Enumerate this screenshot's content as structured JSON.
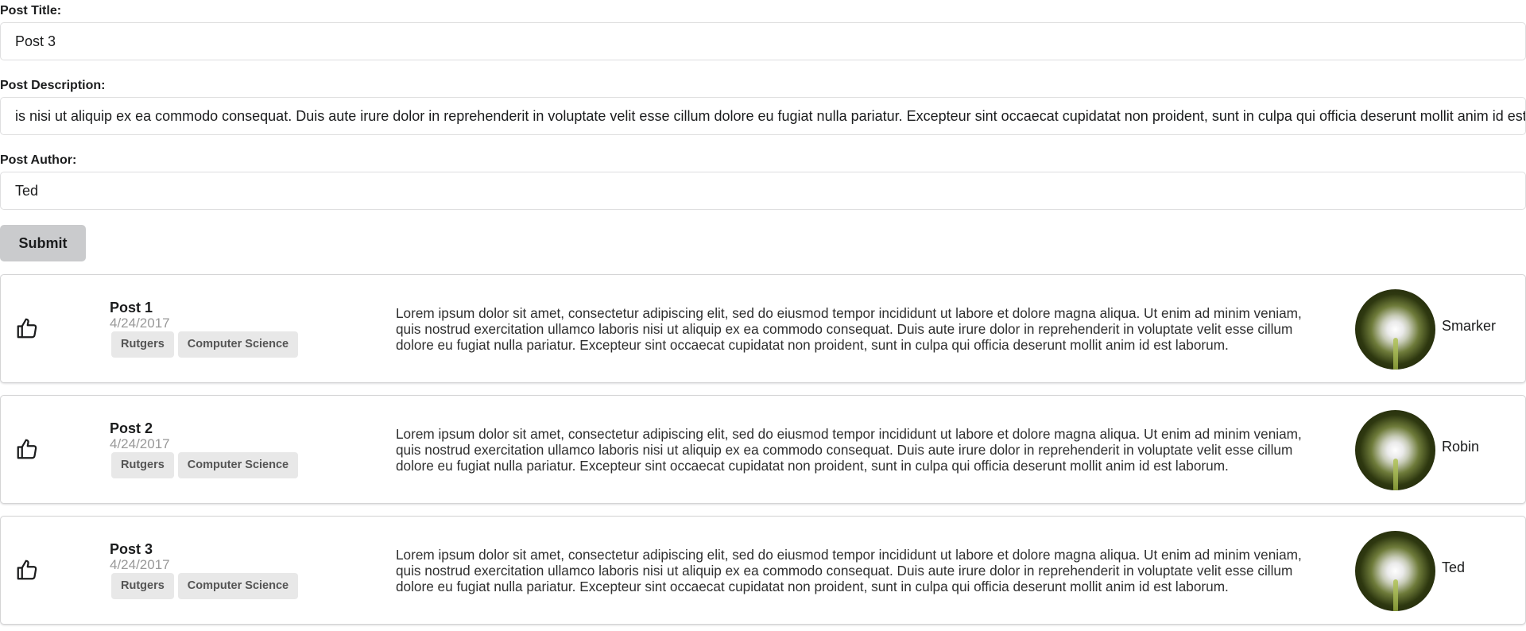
{
  "form": {
    "title_label": "Post Title:",
    "title_value": "Post 3",
    "description_label": "Post Description:",
    "description_value": "is nisi ut aliquip ex ea commodo consequat. Duis aute irure dolor in reprehenderit in voluptate velit esse cillum dolore eu fugiat nulla pariatur. Excepteur sint occaecat cupidatat non proident, sunt in culpa qui officia deserunt mollit anim id est laborum.",
    "author_label": "Post Author:",
    "author_value": "Ted",
    "submit_label": "Submit"
  },
  "posts": [
    {
      "title": "Post 1",
      "date": "4/24/2017",
      "tags": [
        "Rutgers",
        "Computer Science"
      ],
      "description": "Lorem ipsum dolor sit amet, consectetur adipiscing elit, sed do eiusmod tempor incididunt ut labore et dolore magna aliqua. Ut enim ad minim veniam, quis nostrud exercitation ullamco laboris nisi ut aliquip ex ea commodo consequat. Duis aute irure dolor in reprehenderit in voluptate velit esse cillum dolore eu fugiat nulla pariatur. Excepteur sint occaecat cupidatat non proident, sunt in culpa qui officia deserunt mollit anim id est laborum.",
      "author": "Smarker"
    },
    {
      "title": "Post 2",
      "date": "4/24/2017",
      "tags": [
        "Rutgers",
        "Computer Science"
      ],
      "description": "Lorem ipsum dolor sit amet, consectetur adipiscing elit, sed do eiusmod tempor incididunt ut labore et dolore magna aliqua. Ut enim ad minim veniam, quis nostrud exercitation ullamco laboris nisi ut aliquip ex ea commodo consequat. Duis aute irure dolor in reprehenderit in voluptate velit esse cillum dolore eu fugiat nulla pariatur. Excepteur sint occaecat cupidatat non proident, sunt in culpa qui officia deserunt mollit anim id est laborum.",
      "author": "Robin"
    },
    {
      "title": "Post 3",
      "date": "4/24/2017",
      "tags": [
        "Rutgers",
        "Computer Science"
      ],
      "description": "Lorem ipsum dolor sit amet, consectetur adipiscing elit, sed do eiusmod tempor incididunt ut labore et dolore magna aliqua. Ut enim ad minim veniam, quis nostrud exercitation ullamco laboris nisi ut aliquip ex ea commodo consequat. Duis aute irure dolor in reprehenderit in voluptate velit esse cillum dolore eu fugiat nulla pariatur. Excepteur sint occaecat cupidatat non proident, sunt in culpa qui officia deserunt mollit anim id est laborum.",
      "author": "Ted"
    }
  ],
  "icons": {
    "like": "thumbs-up-icon",
    "avatar": "dandelion-avatar"
  }
}
